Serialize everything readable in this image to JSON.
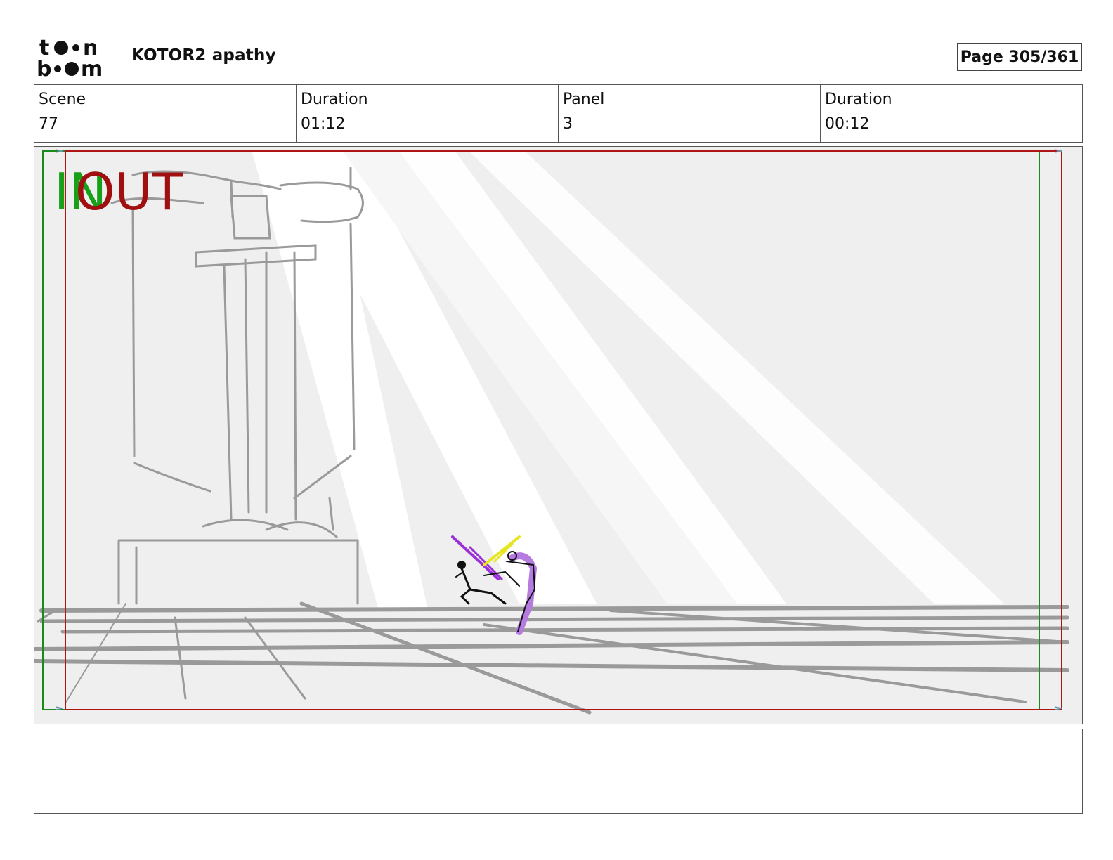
{
  "header": {
    "logo_text": "toon boom",
    "project_title": "KOTOR2 apathy",
    "page_label": "Page 305/361"
  },
  "info": {
    "scene_label": "Scene",
    "scene_value": "77",
    "scene_duration_label": "Duration",
    "scene_duration_value": "01:12",
    "panel_label": "Panel",
    "panel_value": "3",
    "panel_duration_label": "Duration",
    "panel_duration_value": "00:12"
  },
  "panel": {
    "in_marker": "IN",
    "out_marker": "OUT"
  },
  "notes": {
    "text": ""
  },
  "colors": {
    "in_frame": "#1a8a1a",
    "out_frame": "#b01515",
    "sketch_gray": "#9a9a9a",
    "background_gray": "#efefef",
    "saber_purple": "#9b30d9",
    "saber_yellow": "#e6e620"
  }
}
